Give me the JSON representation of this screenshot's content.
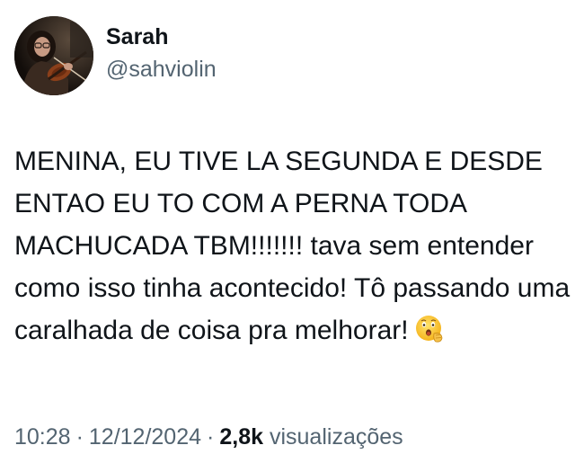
{
  "author": {
    "display_name": "Sarah",
    "handle": "@sahviolin"
  },
  "tweet": {
    "text": "MENINA, EU TIVE LA SEGUNDA E DESDE ENTAO EU TO COM A PERNA TODA MACHUCADA TBM!!!!!!! tava sem entender como isso tinha acontecido! Tô passando uma caralhada de coisa pra melhorar!",
    "emoji": "astonished-face-with-hand-emoji"
  },
  "meta": {
    "time": "10:28",
    "separator": "·",
    "date": "12/12/2024",
    "views_count": "2,8k",
    "views_label": "visualizações"
  },
  "colors": {
    "text_primary": "#0f1419",
    "text_secondary": "#536471",
    "background": "#ffffff"
  }
}
